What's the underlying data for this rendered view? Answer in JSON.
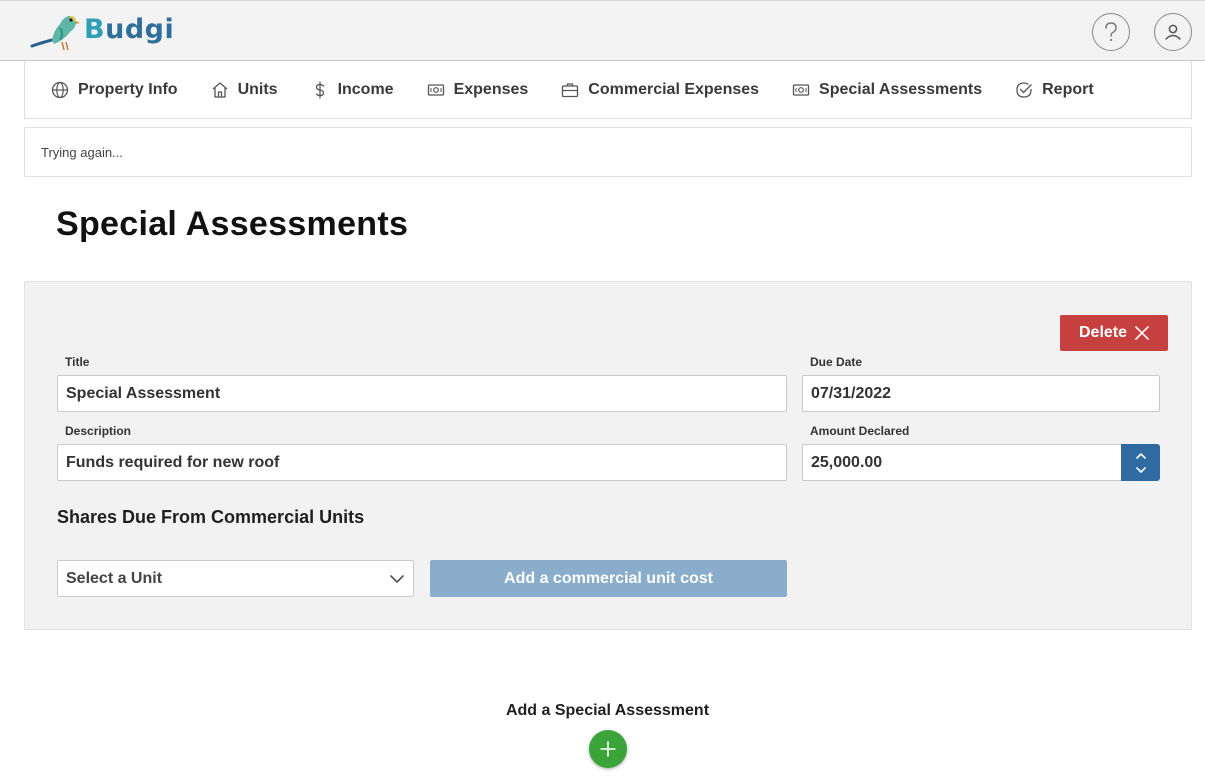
{
  "app": {
    "logo_text_b": "B",
    "logo_text_rest": "udgi"
  },
  "header": {
    "help_icon": "question-icon",
    "account_icon": "user-icon"
  },
  "nav": {
    "items": [
      {
        "label": "Property Info",
        "icon": "globe-icon"
      },
      {
        "label": "Units",
        "icon": "home-icon"
      },
      {
        "label": "Income",
        "icon": "dollar-icon"
      },
      {
        "label": "Expenses",
        "icon": "banknote-icon"
      },
      {
        "label": "Commercial Expenses",
        "icon": "briefcase-icon"
      },
      {
        "label": "Special Assessments",
        "icon": "banknote-icon"
      },
      {
        "label": "Report",
        "icon": "check-circle-icon"
      }
    ]
  },
  "alert": {
    "text": "Trying again..."
  },
  "page": {
    "title": "Special Assessments"
  },
  "assessment": {
    "delete_label": "Delete",
    "title_label": "Title",
    "title_value": "Special Assessment",
    "due_date_label": "Due Date",
    "due_date_value": "07/31/2022",
    "description_label": "Description",
    "description_value": "Funds required for new roof",
    "amount_label": "Amount Declared",
    "amount_value": "25,000.00",
    "shares_title": "Shares Due From Commercial Units",
    "unit_select_value": "Select a Unit",
    "add_unit_cost_label": "Add a commercial unit cost"
  },
  "footer": {
    "add_label": "Add a Special Assessment"
  },
  "colors": {
    "delete": "#c6403f",
    "spinner": "#2f6ba0",
    "add_unit_button": "#8aadcc",
    "add_button": "#3aa43a"
  }
}
